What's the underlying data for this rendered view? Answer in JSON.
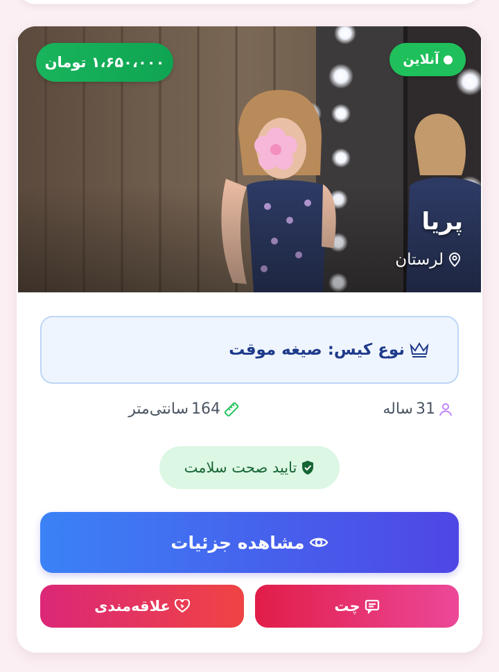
{
  "profile": {
    "price": "۱،۶۵۰،۰۰۰ تومان",
    "status": "آنلاین",
    "name": "پریا",
    "location": "لرستان",
    "case_type": "نوع کیس: صیغه موقت",
    "age": "31",
    "age_unit": "ساله",
    "height": "164",
    "height_unit": "سانتی‌متر",
    "health": "تایید صحت سلامت"
  },
  "actions": {
    "details": "مشاهده جزئیات",
    "chat": "چت",
    "favorite": "علاقه‌مندی"
  },
  "colors": {
    "online": "#1fbf5b",
    "price_badge": "#19b45c",
    "case_text": "#1e3a8a",
    "details_start": "#3b82f6",
    "details_end": "#4f46e5",
    "chat_start": "#ec4899",
    "chat_end": "#e11d48",
    "fav_start": "#ef4444",
    "fav_end": "#db2777",
    "health_bg": "#dcf7e4"
  },
  "icons": {
    "online": "dot-icon",
    "location": "map-pin-icon",
    "case": "crown-icon",
    "age": "user-icon",
    "height": "ruler-icon",
    "health": "shield-check-icon",
    "details": "eye-icon",
    "chat": "chat-icon",
    "favorite": "heart-icon"
  }
}
